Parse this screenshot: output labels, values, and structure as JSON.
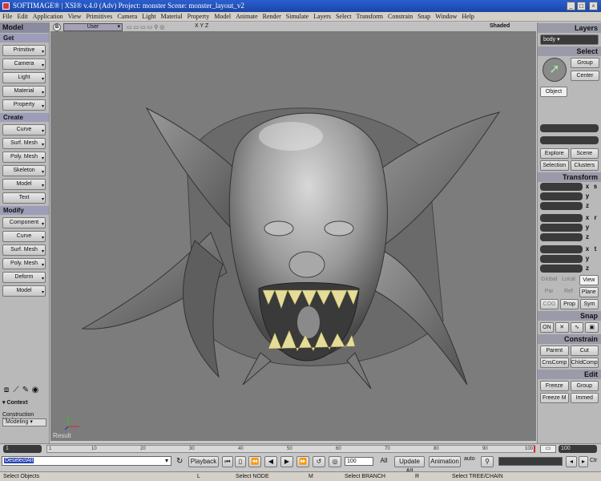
{
  "window": {
    "title": "SOFTIMAGE® | XSI® v.4.0 (Adv)  Project: monster     Scene: monster_layout_v2"
  },
  "menu": [
    "File",
    "Edit",
    "Application",
    "View",
    "Primitives",
    "Camera",
    "Light",
    "Material",
    "Property",
    "Model",
    "Animate",
    "Render",
    "Simulate",
    "Layers",
    "Select",
    "Transform",
    "Constrain",
    "Snap",
    "Window",
    "Help"
  ],
  "left_panel": {
    "title": "Model",
    "get_header": "Get",
    "get_items": [
      "Primitive",
      "Camera",
      "Light",
      "Material",
      "Property"
    ],
    "create_header": "Create",
    "create_items": [
      "Curve",
      "Surf. Mesh",
      "Poly. Mesh",
      "Skeleton",
      "Model",
      "Text"
    ],
    "modify_header": "Modify",
    "modify_items": [
      "Component",
      "Curve",
      "Surf. Mesh",
      "Poly. Mesh",
      "Deform",
      "Model"
    ],
    "context_label": "Context",
    "construction_mode_label": "Construction Mode",
    "construction_mode_value": "Modeling"
  },
  "viewport": {
    "badge": "B",
    "camera": "User",
    "axes": "X  Y  Z",
    "shading": "Shaded",
    "result_label": "Result"
  },
  "right_panel": {
    "layers_title": "Layers",
    "layer_value": "body",
    "select_title": "Select",
    "group_btn": "Group",
    "center_btn": "Center",
    "object_btn": "Object",
    "explore_btn": "Explore",
    "scene_btn": "Scene",
    "selection_btn": "Selection",
    "clusters_btn": "Clusters",
    "transform_title": "Transform",
    "axis_x": "x",
    "axis_y": "y",
    "axis_z": "z",
    "s_label": "s",
    "r_label": "r",
    "t_label": "t",
    "global_btn": "Global",
    "local_btn": "Local",
    "view_btn": "View",
    "par_btn": "Par",
    "ref_btn": "Ref",
    "plane_btn": "Plane",
    "cog_btn": "COG",
    "prop_btn": "Prop",
    "sym_btn": "Sym",
    "snap_title": "Snap",
    "snap_on": "ON",
    "constrain_title": "Constrain",
    "parent_btn": "Parent",
    "cut_btn": "Cut",
    "cnscomp_btn": "CnsComp",
    "chldcomp_btn": "ChldComp",
    "edit_title": "Edit",
    "freeze_btn": "Freeze",
    "group_edit_btn": "Group",
    "freezem_btn": "Freeze M",
    "immed_btn": "Immed"
  },
  "timeline": {
    "start_frame": "1",
    "end_frame": "100",
    "tick_labels": [
      "1",
      "10",
      "20",
      "30",
      "40",
      "50",
      "60",
      "70",
      "80",
      "90",
      "100"
    ]
  },
  "playback": {
    "command": "DeselectAll",
    "playback_btn": "Playback",
    "frame_value": "100",
    "all_btn": "All",
    "update_all_btn": "Update All",
    "animation_btn": "Animation",
    "auto_label": "auto",
    "ctrl_label": "Ctr"
  },
  "status": {
    "left_mouse": "Select Objects",
    "l_key": "L",
    "middle_mouse": "Select NODE",
    "m_key": "M",
    "right_mouse": "Select BRANCH",
    "r_key": "R",
    "tree_chain": "Select TREE/CHAIN"
  },
  "colors": {
    "viewport_bg": "#7c7c7c",
    "title_bar": "#1a45a8",
    "panel_bg": "#b9b9b9",
    "teeth": "#e6dc9a"
  }
}
